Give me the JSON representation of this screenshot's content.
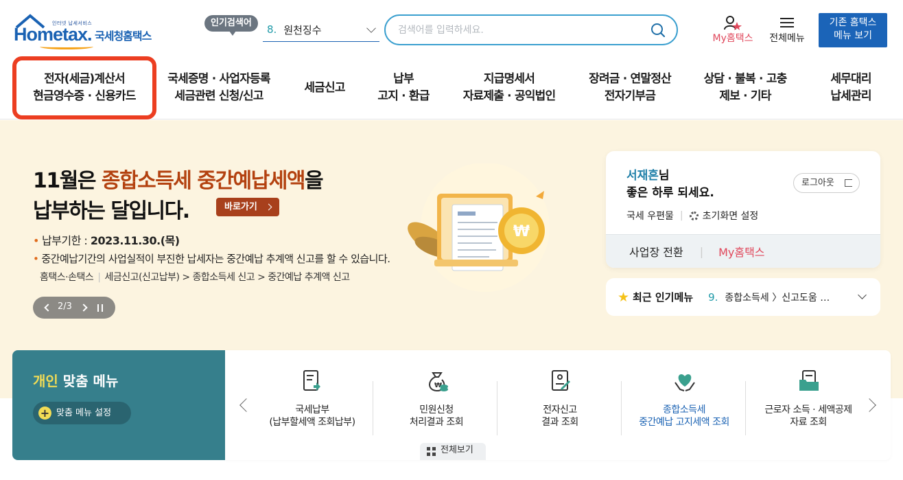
{
  "logo": {
    "tagline": "인터넷 납세서비스",
    "wordmark": "Hometax.",
    "name": "국세청홈택스"
  },
  "header": {
    "popular_tag": "인기검색어",
    "popular_num": "8.",
    "popular_term": "원천징수",
    "search_placeholder": "검색어를 입력하세요.",
    "my_hometax": "My홈택스",
    "all_menu": "전체메뉴",
    "old_menu_line1": "기존 홈택스",
    "old_menu_line2": "메뉴 보기"
  },
  "nav": [
    {
      "l1": "전자(세금)계산서",
      "l2": "현금영수증 · 신용카드"
    },
    {
      "l1": "국세증명 · 사업자등록",
      "l2": "세금관련 신청/신고"
    },
    {
      "l1": "세금신고",
      "l2": ""
    },
    {
      "l1": "납부",
      "l2": "고지 · 환급"
    },
    {
      "l1": "지급명세서",
      "l2": "자료제출 · 공익법인"
    },
    {
      "l1": "장려금 · 연말정산",
      "l2": "전자기부금"
    },
    {
      "l1": "상담 · 불복 · 고충",
      "l2": "제보 · 기타"
    },
    {
      "l1": "세무대리",
      "l2": "납세관리"
    }
  ],
  "banner": {
    "line1_pre": "11월은 ",
    "line1_hl": "종합소득세 중간예납세액",
    "line1_post": "을",
    "line2": "납부하는 달입니다.",
    "goto_btn": "바로가기",
    "due_label": "납부기한 : ",
    "due_value": "2023.11.30.(목)",
    "note": "중간예납기간의 사업실적이 부진한 납세자는 중간예납 추계액 신고를 할 수 있습니다.",
    "path_a": "홈택스·손택스",
    "path_b": "세금신고(신고납부) > 종합소득세 신고 > 중간예납 추계액 신고",
    "slide_counter": "2/3"
  },
  "user": {
    "name": "서재흔",
    "suffix": "님",
    "greeting": "좋은 하루 되세요.",
    "logout": "로그아웃",
    "mail": "국세 우편물",
    "home_setting": "초기화면 설정",
    "switch_biz": "사업장 전환",
    "my_hometax": "My홈택스"
  },
  "recent": {
    "label": "최근 인기메뉴",
    "num": "9.",
    "text": "종합소득세 〉신고도움 …"
  },
  "custom_menu": {
    "title_hl": "개인",
    "title_rest": " 맞춤 메뉴",
    "setting_btn": "맞춤 메뉴 설정",
    "items": [
      {
        "l1": "국세납부",
        "l2": "(납부할세액 조회납부)"
      },
      {
        "l1": "민원신청",
        "l2": "처리결과 조회"
      },
      {
        "l1": "전자신고",
        "l2": "결과 조회"
      },
      {
        "l1": "종합소득세",
        "l2": "중간예납 고지세액 조회"
      },
      {
        "l1": "근로자 소득 · 세액공제",
        "l2": "자료 조회"
      }
    ],
    "view_all": "전체보기"
  },
  "colors": {
    "brand_blue": "#1a62b3",
    "teal": "#367f8c",
    "accent_red": "#ec3e21",
    "pink": "#e0475b",
    "banner_bg": "#fcf4e0"
  }
}
